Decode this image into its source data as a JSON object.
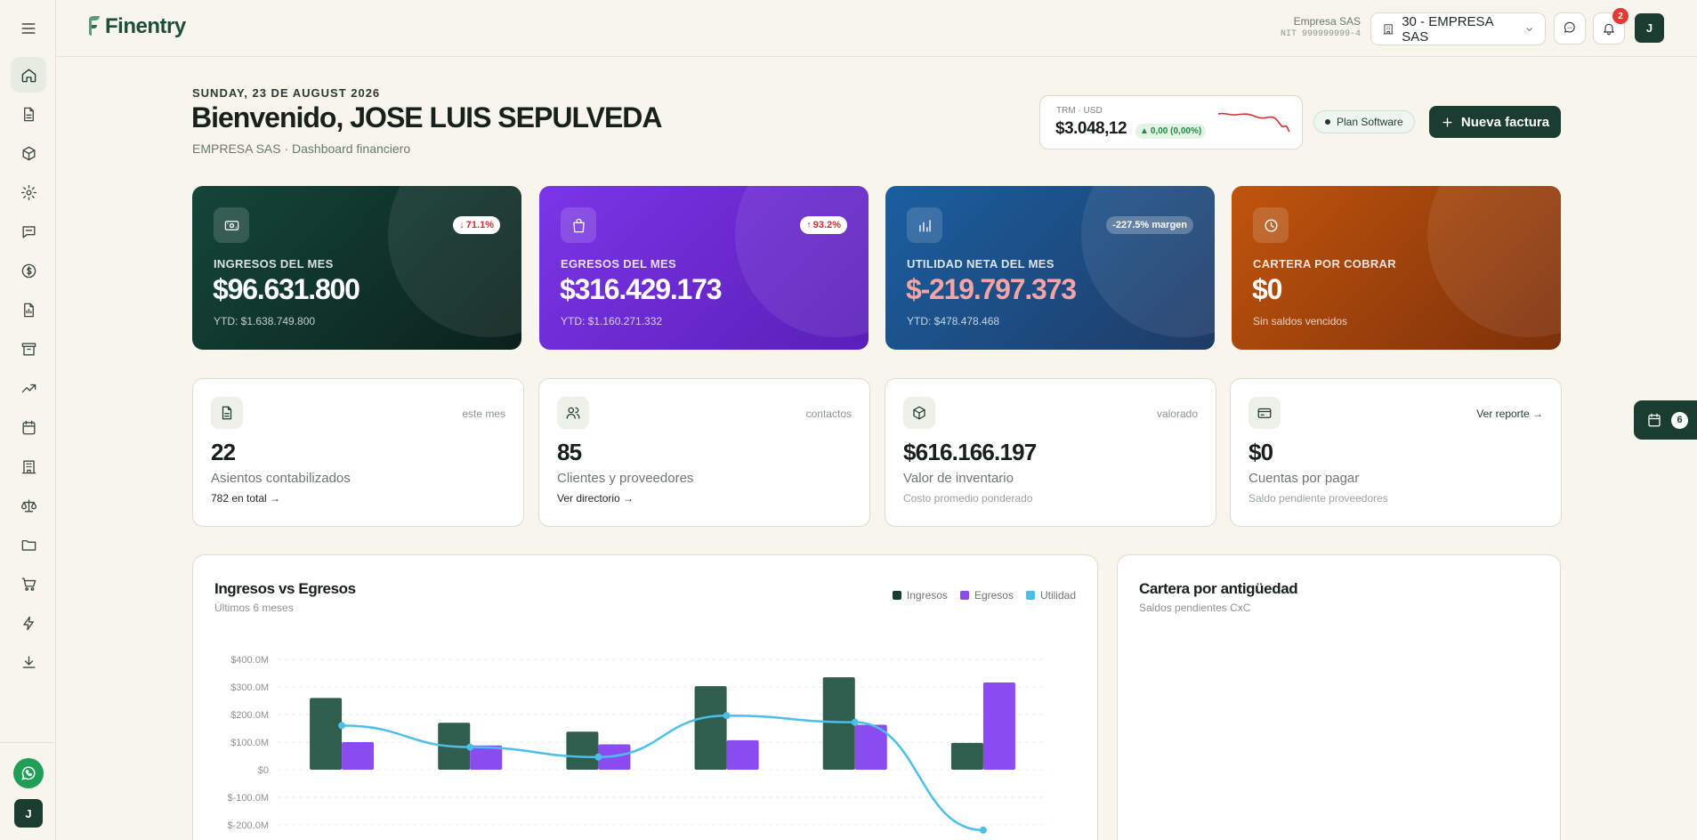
{
  "app": {
    "name": "Finentry"
  },
  "sidebar": {
    "items": [
      {
        "name": "home",
        "active": true
      },
      {
        "name": "documents"
      },
      {
        "name": "inventory"
      },
      {
        "name": "settings"
      },
      {
        "name": "messages"
      },
      {
        "name": "payments"
      },
      {
        "name": "reports"
      },
      {
        "name": "archive"
      },
      {
        "name": "trends"
      },
      {
        "name": "calendar"
      },
      {
        "name": "company"
      },
      {
        "name": "legal"
      },
      {
        "name": "files"
      },
      {
        "name": "shop"
      },
      {
        "name": "automation"
      },
      {
        "name": "download"
      }
    ],
    "avatar": "J"
  },
  "topbar": {
    "company_name": "Empresa SAS",
    "nit": "NIT 999999999-4",
    "company_select": "30 - EMPRESA SAS",
    "notifications": "2",
    "avatar": "J"
  },
  "header": {
    "date": "SUNDAY, 23 DE AUGUST 2026",
    "welcome": "Bienvenido, JOSE LUIS SEPULVEDA",
    "subtitle": "EMPRESA SAS · Dashboard financiero",
    "trm_label": "TRM · USD",
    "trm_value": "$3.048,12",
    "trm_change": "0,00 (0,00%)",
    "plan": "Plan Software",
    "new_invoice": "Nueva factura"
  },
  "kpis": [
    {
      "label": "INGRESOS DEL MES",
      "value": "$96.631.800",
      "sub": "YTD: $1.638.749.800",
      "badge": "71.1%",
      "trend": "down",
      "color_from": "#14463a",
      "color_to": "#0b211b"
    },
    {
      "label": "EGRESOS DEL MES",
      "value": "$316.429.173",
      "sub": "YTD: $1.160.271.332",
      "badge": "93.2%",
      "trend": "up",
      "color_from": "#7b35e6",
      "color_to": "#5a1fb8"
    },
    {
      "label": "UTILIDAD NETA DEL MES",
      "value": "$-219.797.373",
      "sub": "YTD: $478.478.468",
      "badge": "-227.5% margen",
      "color_from": "#1a5fa0",
      "color_to": "#1f3b66"
    },
    {
      "label": "CARTERA POR COBRAR",
      "value": "$0",
      "sub": "Sin saldos vencidos",
      "color_from": "#c0550c",
      "color_to": "#7d300a"
    }
  ],
  "stats": [
    {
      "tag": "este mes",
      "number": "22",
      "desc": "Asientos contabilizados",
      "foot": "782 en total →"
    },
    {
      "tag": "contactos",
      "number": "85",
      "desc": "Clientes y proveedores",
      "foot": "Ver directorio →"
    },
    {
      "tag": "valorado",
      "number": "$616.166.197",
      "desc": "Valor de inventario",
      "foot": "Costo promedio ponderado"
    },
    {
      "tag": "Ver reporte →",
      "number": "$0",
      "desc": "Cuentas por pagar",
      "foot": "Saldo pendiente proveedores"
    }
  ],
  "floating_tab": {
    "count": "6"
  },
  "charts_panel": {
    "title": "Ingresos vs Egresos",
    "subtitle": "Últimos 6 meses",
    "legend": [
      "Ingresos",
      "Egresos",
      "Utilidad"
    ]
  },
  "aging_panel": {
    "title": "Cartera por antigüedad",
    "subtitle": "Saldos pendientes CxC"
  },
  "chart_data": {
    "type": "bar",
    "categories": [
      "",
      "",
      "",
      "",
      "",
      ""
    ],
    "series": [
      {
        "name": "Ingresos",
        "values": [
          260,
          170,
          138,
          303,
          335,
          97
        ],
        "color": "#2f5e4e"
      },
      {
        "name": "Egresos",
        "values": [
          100,
          88,
          92,
          107,
          163,
          316
        ],
        "color": "#8a4cf0"
      },
      {
        "name": "Utilidad",
        "values": [
          160,
          82,
          46,
          196,
          172,
          -219
        ],
        "color": "#4bbfe9",
        "kind": "line"
      }
    ],
    "yticks": [
      "$400.0M",
      "$300.0M",
      "$200.0M",
      "$100.0M",
      "$0",
      "$-100.0M",
      "$-200.0M"
    ],
    "ylim": [
      -200,
      400
    ],
    "grid": true,
    "legend": "top-right"
  },
  "colors": {
    "brand": "#1b3d31",
    "accent": "#4bbfe9",
    "background": "#f7f5ec"
  }
}
